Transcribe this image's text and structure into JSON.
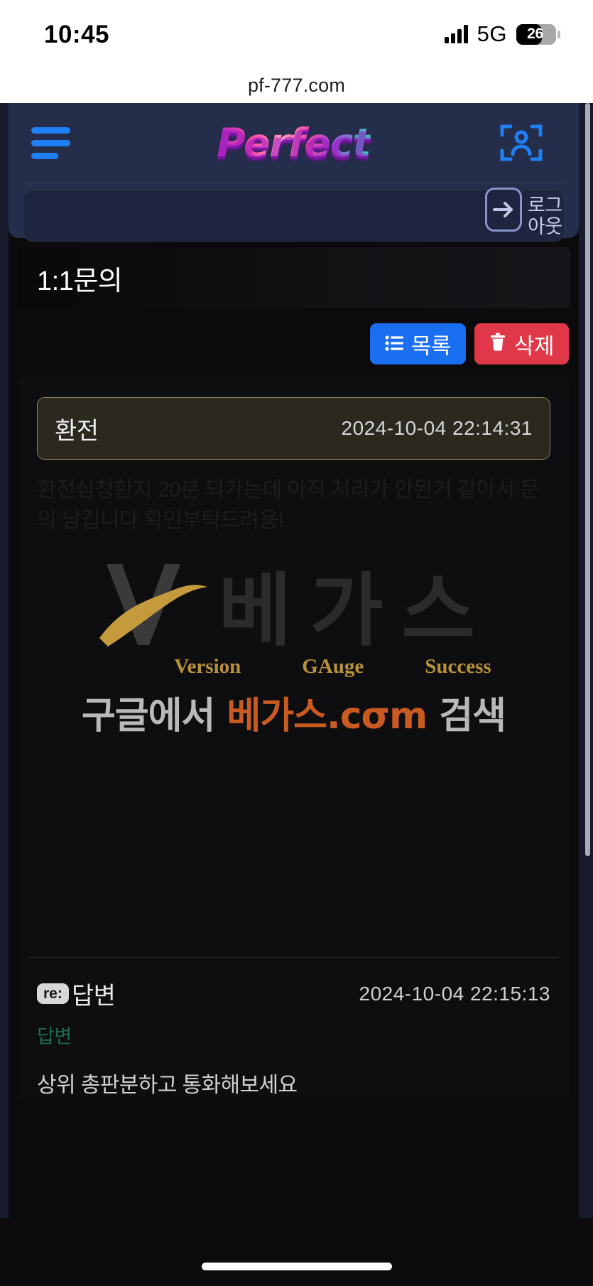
{
  "status_bar": {
    "time": "10:45",
    "network": "5G",
    "battery_percent": "26",
    "signal_icon": "cellular-bars-icon",
    "battery_icon": "battery-icon"
  },
  "browser": {
    "url": "pf-777.com"
  },
  "site_header": {
    "menu_icon": "hamburger-menu-icon",
    "logo_text": "Perfect",
    "face_icon": "face-id-icon",
    "search_value": "",
    "search_placeholder": "",
    "logout_icon": "logout-arrow-icon",
    "logout_label_line1": "로그",
    "logout_label_line2": "아웃"
  },
  "page": {
    "title": "1:1문의"
  },
  "actions": {
    "list_label": "목록",
    "list_icon": "list-icon",
    "delete_label": "삭제",
    "delete_icon": "trash-icon"
  },
  "post": {
    "title": "환전",
    "date": "2024-10-04 22:14:31",
    "body": "환전심청한지 20분 되가는데 아직 처리가 안된거 같아서 문의 남깁니다 확인부탁드려용!"
  },
  "ad": {
    "logo_icon": "vegas-v-logo-icon",
    "brand_korean": "베가스",
    "sub_labels": [
      "Version",
      "GAuge",
      "Success"
    ],
    "search_prefix": "구글에서 ",
    "search_brand": "베가스.cσm",
    "search_suffix": " 검색"
  },
  "reply": {
    "badge": "re:",
    "title": "답변",
    "date": "2024-10-04 22:15:13",
    "label": "답변",
    "body": "상위 총판분하고 통화해보세요"
  },
  "colors": {
    "header_bg": "#242d49",
    "accent_blue": "#1f7ff5",
    "list_button": "#1a6ef0",
    "delete_button": "#e03848",
    "post_head_border": "#8a8257",
    "reply_label_green": "#1f6b52",
    "ad_gold": "#b89239",
    "ad_orange": "#c85a22"
  }
}
